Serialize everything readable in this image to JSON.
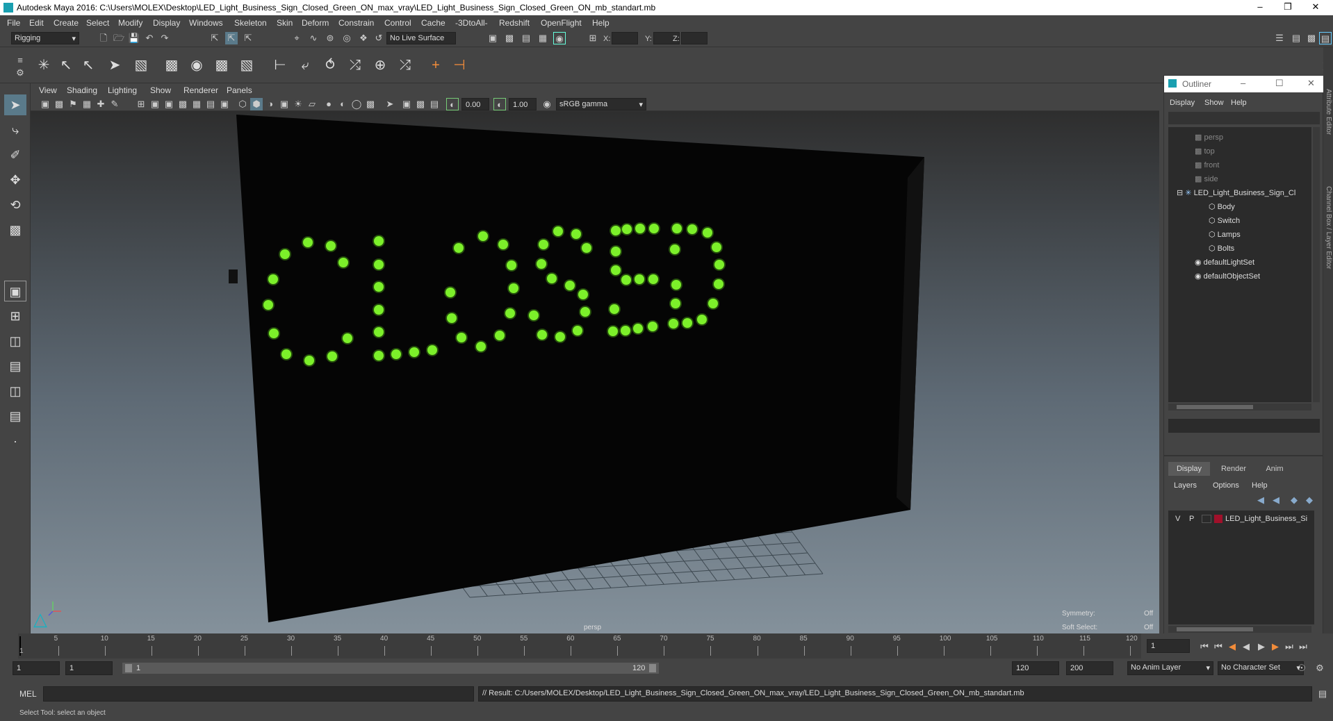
{
  "window": {
    "title": "Autodesk Maya 2016: C:\\Users\\MOLEX\\Desktop\\LED_Light_Business_Sign_Closed_Green_ON_max_vray\\LED_Light_Business_Sign_Closed_Green_ON_mb_standart.mb"
  },
  "menu": [
    "File",
    "Edit",
    "Create",
    "Select",
    "Modify",
    "Display",
    "Windows",
    "Skeleton",
    "Skin",
    "Deform",
    "Constrain",
    "Control",
    "Cache",
    "-3DtoAll-",
    "Redshift",
    "OpenFlight",
    "Help"
  ],
  "status": {
    "mode": "Rigging",
    "live_surface": "No Live Surface",
    "x_label": "X:",
    "y_label": "Y:",
    "z_label": "Z:"
  },
  "panel_menu": [
    "View",
    "Shading",
    "Lighting",
    "Show",
    "Renderer",
    "Panels"
  ],
  "panel_toolbar": {
    "exposure": "0.00",
    "gamma": "1.00",
    "color_space": "sRGB gamma"
  },
  "viewport": {
    "camera": "persp",
    "symmetry_label": "Symmetry:",
    "symmetry_value": "Off",
    "soft_select_label": "Soft Select:",
    "soft_select_value": "Off",
    "sign_text": "CLOSED"
  },
  "outliner": {
    "title": "Outliner",
    "menu": [
      "Display",
      "Show",
      "Help"
    ],
    "cameras": [
      "persp",
      "top",
      "front",
      "side"
    ],
    "group": "LED_Light_Business_Sign_Cl",
    "children": [
      "Body",
      "Switch",
      "Lamps",
      "Bolts"
    ],
    "sets": [
      "defaultLightSet",
      "defaultObjectSet"
    ]
  },
  "channel_box": {
    "tabs": [
      "Display",
      "Render",
      "Anim"
    ],
    "menu": [
      "Layers",
      "Options",
      "Help"
    ],
    "layer": {
      "v": "V",
      "p": "P",
      "name": "LED_Light_Business_Si"
    }
  },
  "timeline": {
    "ticks": [
      "5",
      "10",
      "15",
      "20",
      "25",
      "30",
      "35",
      "40",
      "45",
      "50",
      "55",
      "60",
      "65",
      "70",
      "75",
      "80",
      "85",
      "90",
      "95",
      "100",
      "105",
      "110",
      "115",
      "120"
    ],
    "start_label": "1",
    "current_frame": "1"
  },
  "range": {
    "start": "1",
    "inner_start": "1",
    "slider_start": "1",
    "slider_end": "120",
    "end": "120",
    "max": "200",
    "anim_layer": "No Anim Layer",
    "char_set": "No Character Set"
  },
  "mel": {
    "label": "MEL",
    "result": "// Result: C:/Users/MOLEX/Desktop/LED_Light_Business_Sign_Closed_Green_ON_max_vray/LED_Light_Business_Sign_Closed_Green_ON_mb_standart.mb"
  },
  "help": {
    "text": "Select Tool: select an object"
  },
  "colors": {
    "led": "#7cf02a",
    "layer_swatch": "#a0102a",
    "accent": "#5aa8c8"
  }
}
